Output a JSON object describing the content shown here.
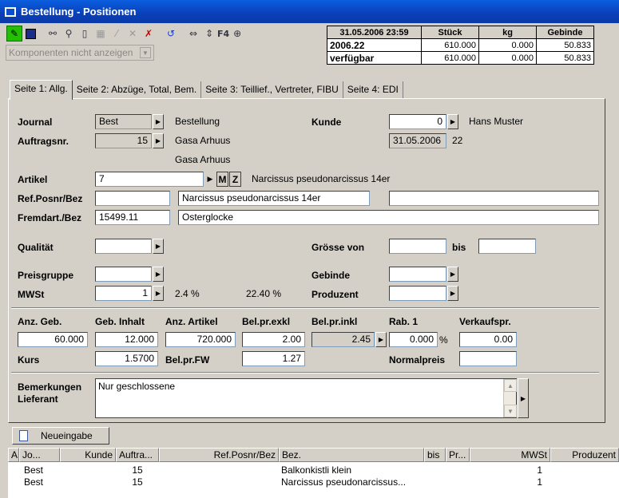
{
  "window": {
    "title": "Bestellung - Positionen"
  },
  "toolbar": {
    "f4_label": "F4",
    "icons": [
      "edit-icon",
      "save-icon",
      "binoculars-icon",
      "search-icon",
      "new-document-icon",
      "grid-icon",
      "brush-icon",
      "cancel-icon",
      "delete-icon",
      "refresh-icon",
      "fit-width-icon",
      "fit-page-icon",
      "zoom-icon"
    ]
  },
  "komponenten": {
    "value": "Komponenten nicht anzeigen"
  },
  "stat": {
    "header_date": "31.05.2006 23:59",
    "col_stueck": "Stück",
    "col_kg": "kg",
    "col_gebinde": "Gebinde",
    "rows": [
      {
        "label": "2006.22",
        "stueck": "610.000",
        "kg": "0.000",
        "gebinde": "50.833"
      },
      {
        "label": "verfügbar",
        "stueck": "610.000",
        "kg": "0.000",
        "gebinde": "50.833"
      }
    ]
  },
  "tabs": [
    "Seite 1: Allg.",
    "Seite 2: Abzüge, Total, Bem.",
    "Seite 3: Teillief., Vertreter, FIBU",
    "Seite 4: EDI"
  ],
  "form": {
    "journal_label": "Journal",
    "journal_value": "Best",
    "journal_text": "Bestellung",
    "auftragsnr_label": "Auftragsnr.",
    "auftragsnr_value": "15",
    "auftragsnr_text1": "Gasa Arhuus",
    "auftragsnr_text2": "Gasa Arhuus",
    "kunde_label": "Kunde",
    "kunde_value": "0",
    "kunde_name": "Hans Muster",
    "kunde_date": "31.05.2006",
    "kunde_week": "22",
    "artikel_label": "Artikel",
    "artikel_value": "7",
    "artikel_m": "M",
    "artikel_z": "Z",
    "artikel_text": "Narcissus pseudonarcissus 14er",
    "refposnr_label": "Ref.Posnr/Bez",
    "refposnr_value": "",
    "refposnr_bez": "Narcissus pseudonarcissus 14er",
    "refposnr_extra": "",
    "fremdart_label": "Fremdart./Bez",
    "fremdart_value": "15499.11",
    "fremdart_bez": "Osterglocke",
    "qualitaet_label": "Qualität",
    "qualitaet_value": "",
    "groesse_label": "Grösse von",
    "groesse_von": "",
    "bis_label": "bis",
    "groesse_bis": "",
    "preisgruppe_label": "Preisgruppe",
    "preisgruppe_value": "",
    "gebinde_label": "Gebinde",
    "gebinde_value": "",
    "mwst_label": "MWSt",
    "mwst_value": "1",
    "mwst_rate": "2.4 %",
    "mwst_rate2": "22.40 %",
    "produzent_label": "Produzent",
    "produzent_value": "",
    "anzgeb_label": "Anz. Geb.",
    "anzgeb_value": "60.000",
    "gebinhalt_label": "Geb. Inhalt",
    "gebinhalt_value": "12.000",
    "anzartikel_label": "Anz. Artikel",
    "anzartikel_value": "720.000",
    "belprexkl_label": "Bel.pr.exkl",
    "belprexkl_value": "2.00",
    "belprinkl_label": "Bel.pr.inkl",
    "belprinkl_value": "2.45",
    "rab_label": "Rab. 1",
    "rab_value": "0.000",
    "rab_unit": "%",
    "verkaufspr_label": "Verkaufspr.",
    "verkaufspr_value": "0.00",
    "kurs_label": "Kurs",
    "kurs_value": "1.5700",
    "belprfw_label": "Bel.pr.FW",
    "belprfw_value": "1.27",
    "normalpreis_label": "Normalpreis",
    "normalpreis_value": "",
    "bemerkungen_label1": "Bemerkungen",
    "bemerkungen_label2": "Lieferant",
    "bemerkungen_value": "Nur geschlossene"
  },
  "neueingabe": "Neueingabe",
  "grid": {
    "headers": [
      "A",
      "Jo...",
      "Kunde",
      "Auftra...",
      "Ref.Posnr/Bez",
      "Bez.",
      "bis",
      "Pr...",
      "MWSt",
      "Produzent"
    ],
    "rows": [
      {
        "jo": "Best",
        "kunde": "",
        "auftrag": "15",
        "ref": "",
        "bez": "Balkonkistli klein",
        "bis": "",
        "pr": "",
        "mwst": "1",
        "produzent": ""
      },
      {
        "jo": "Best",
        "kunde": "",
        "auftrag": "15",
        "ref": "",
        "bez": "Narcissus pseudonarcissus...",
        "bis": "",
        "pr": "",
        "mwst": "1",
        "produzent": ""
      }
    ]
  }
}
